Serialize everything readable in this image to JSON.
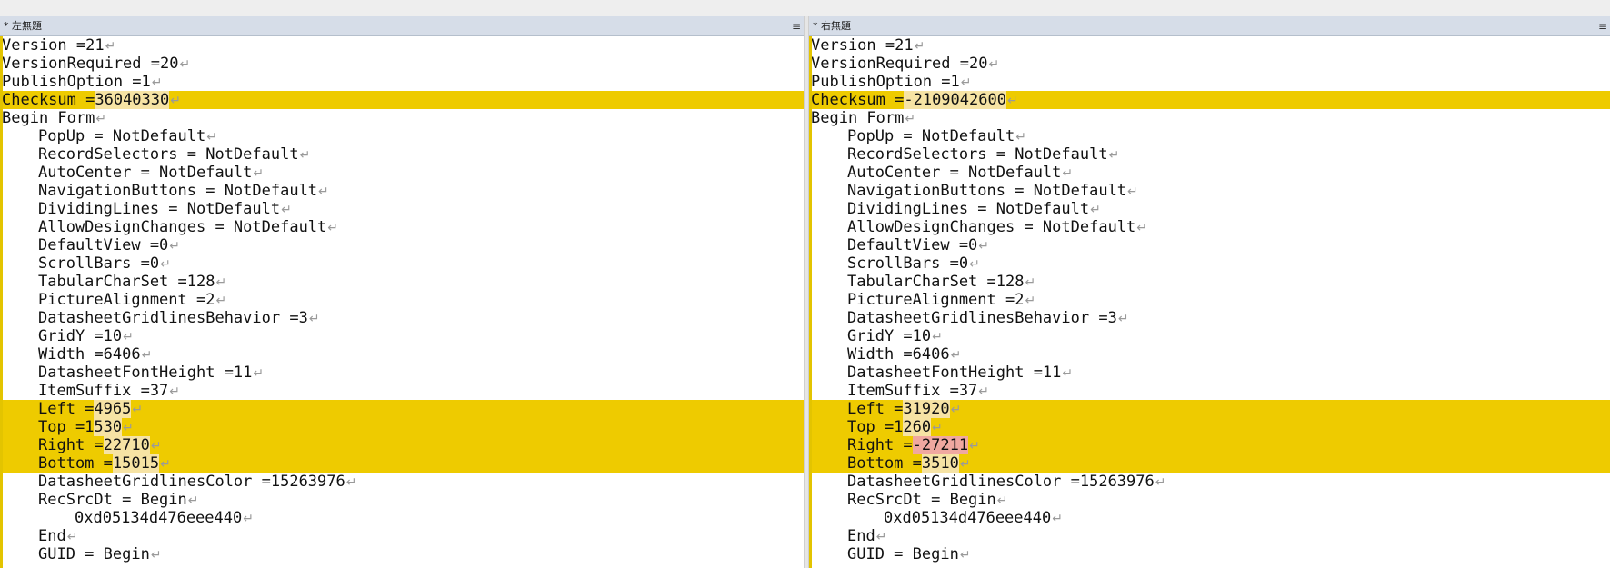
{
  "left_pane": {
    "title": "* 左無題",
    "menu_glyph": "≡",
    "lines": [
      {
        "text": "Version =21",
        "indent": 0,
        "diff": false
      },
      {
        "text": "VersionRequired =20",
        "indent": 0,
        "diff": false
      },
      {
        "text": "PublishOption =1",
        "indent": 0,
        "diff": false
      },
      {
        "prefix": "Checksum =",
        "changed": "36040330",
        "suffix": "",
        "indent": 0,
        "diff": true
      },
      {
        "text": "Begin Form",
        "indent": 0,
        "diff": false
      },
      {
        "text": "PopUp = NotDefault",
        "indent": 1,
        "diff": false
      },
      {
        "text": "RecordSelectors = NotDefault",
        "indent": 1,
        "diff": false
      },
      {
        "text": "AutoCenter = NotDefault",
        "indent": 1,
        "diff": false
      },
      {
        "text": "NavigationButtons = NotDefault",
        "indent": 1,
        "diff": false
      },
      {
        "text": "DividingLines = NotDefault",
        "indent": 1,
        "diff": false
      },
      {
        "text": "AllowDesignChanges = NotDefault",
        "indent": 1,
        "diff": false
      },
      {
        "text": "DefaultView =0",
        "indent": 1,
        "diff": false
      },
      {
        "text": "ScrollBars =0",
        "indent": 1,
        "diff": false
      },
      {
        "text": "TabularCharSet =128",
        "indent": 1,
        "diff": false
      },
      {
        "text": "PictureAlignment =2",
        "indent": 1,
        "diff": false
      },
      {
        "text": "DatasheetGridlinesBehavior =3",
        "indent": 1,
        "diff": false
      },
      {
        "text": "GridY =10",
        "indent": 1,
        "diff": false
      },
      {
        "text": "Width =6406",
        "indent": 1,
        "diff": false
      },
      {
        "text": "DatasheetFontHeight =11",
        "indent": 1,
        "diff": false
      },
      {
        "text": "ItemSuffix =37",
        "indent": 1,
        "diff": false
      },
      {
        "prefix": "Left =",
        "changed": "4965",
        "suffix": "",
        "indent": 1,
        "diff": true
      },
      {
        "prefix": "Top =1",
        "changed": "530",
        "suffix": "",
        "indent": 1,
        "diff": true
      },
      {
        "prefix": "Right =",
        "changed": "22710",
        "suffix": "",
        "indent": 1,
        "diff": true
      },
      {
        "prefix": "Bottom =",
        "changed": "15015",
        "suffix": "",
        "indent": 1,
        "diff": true
      },
      {
        "text": "DatasheetGridlinesColor =15263976",
        "indent": 1,
        "diff": false
      },
      {
        "text": "RecSrcDt = Begin",
        "indent": 1,
        "diff": false
      },
      {
        "text": "0xd05134d476eee440",
        "indent": 2,
        "diff": false
      },
      {
        "text": "End",
        "indent": 1,
        "diff": false
      },
      {
        "text": "GUID = Begin",
        "indent": 1,
        "diff": false
      }
    ]
  },
  "right_pane": {
    "title": "* 右無題",
    "menu_glyph": "≡",
    "lines": [
      {
        "text": "Version =21",
        "indent": 0,
        "diff": false
      },
      {
        "text": "VersionRequired =20",
        "indent": 0,
        "diff": false
      },
      {
        "text": "PublishOption =1",
        "indent": 0,
        "diff": false
      },
      {
        "prefix": "Checksum =",
        "changed": "-2109042600",
        "suffix": "",
        "indent": 0,
        "diff": true
      },
      {
        "text": "Begin Form",
        "indent": 0,
        "diff": false
      },
      {
        "text": "PopUp = NotDefault",
        "indent": 1,
        "diff": false
      },
      {
        "text": "RecordSelectors = NotDefault",
        "indent": 1,
        "diff": false
      },
      {
        "text": "AutoCenter = NotDefault",
        "indent": 1,
        "diff": false
      },
      {
        "text": "NavigationButtons = NotDefault",
        "indent": 1,
        "diff": false
      },
      {
        "text": "DividingLines = NotDefault",
        "indent": 1,
        "diff": false
      },
      {
        "text": "AllowDesignChanges = NotDefault",
        "indent": 1,
        "diff": false
      },
      {
        "text": "DefaultView =0",
        "indent": 1,
        "diff": false
      },
      {
        "text": "ScrollBars =0",
        "indent": 1,
        "diff": false
      },
      {
        "text": "TabularCharSet =128",
        "indent": 1,
        "diff": false
      },
      {
        "text": "PictureAlignment =2",
        "indent": 1,
        "diff": false
      },
      {
        "text": "DatasheetGridlinesBehavior =3",
        "indent": 1,
        "diff": false
      },
      {
        "text": "GridY =10",
        "indent": 1,
        "diff": false
      },
      {
        "text": "Width =6406",
        "indent": 1,
        "diff": false
      },
      {
        "text": "DatasheetFontHeight =11",
        "indent": 1,
        "diff": false
      },
      {
        "text": "ItemSuffix =37",
        "indent": 1,
        "diff": false
      },
      {
        "prefix": "Left =",
        "changed": "31920",
        "suffix": "",
        "indent": 1,
        "diff": true
      },
      {
        "prefix": "Top =1",
        "changed": "260",
        "suffix": "",
        "indent": 1,
        "diff": true
      },
      {
        "prefix": "Right =",
        "changed": "-27211",
        "suffix": "",
        "indent": 1,
        "diff": true,
        "strong": true
      },
      {
        "prefix": "Bottom =",
        "changed": "3510",
        "suffix": "",
        "indent": 1,
        "diff": true
      },
      {
        "text": "DatasheetGridlinesColor =15263976",
        "indent": 1,
        "diff": false
      },
      {
        "text": "RecSrcDt = Begin",
        "indent": 1,
        "diff": false
      },
      {
        "text": "0xd05134d476eee440",
        "indent": 2,
        "diff": false
      },
      {
        "text": "End",
        "indent": 1,
        "diff": false
      },
      {
        "text": "GUID = Begin",
        "indent": 1,
        "diff": false
      }
    ]
  },
  "eol_glyph": "↵",
  "colors": {
    "diff_line": "#eecb00",
    "changed_text": "#f6e3a4",
    "changed_strong": "#f0a8a0",
    "header": "#d6dde8"
  }
}
